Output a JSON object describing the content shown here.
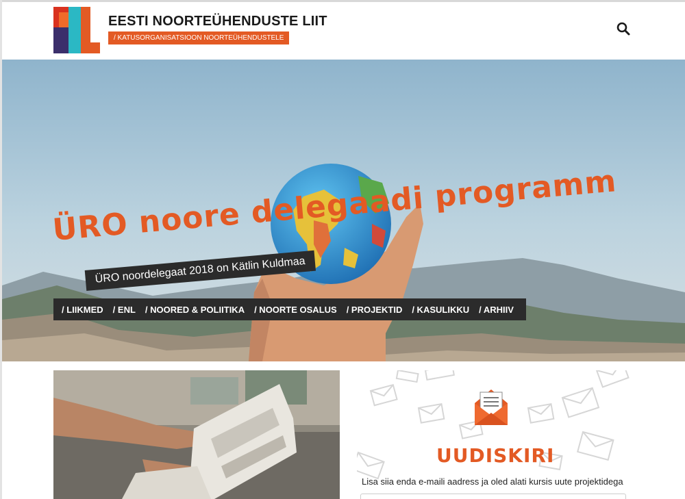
{
  "header": {
    "site_title": "EESTI NOORTEÜHENDUSTE LIIT",
    "tagline": "/ KATUSORGANISATSIOON NOORTEÜHENDUSTELE",
    "logo_icon": "enl-logo-icon",
    "search_icon": "search-icon"
  },
  "hero": {
    "headline": "ÜRO noore delegaadi programm",
    "subtitle": "ÜRO noordelegaat 2018 on Kätlin Kuldmaa"
  },
  "nav": {
    "items": [
      {
        "label": "/ LIIKMED"
      },
      {
        "label": "/ ENL"
      },
      {
        "label": "/ NOORED & POLIITIKA"
      },
      {
        "label": "/ NOORTE OSALUS"
      },
      {
        "label": "/ PROJEKTID"
      },
      {
        "label": "/ KASULIKKU"
      },
      {
        "label": "/ ARHIIV"
      }
    ]
  },
  "newsletter": {
    "title": "UUDISKIRI",
    "text": "Lisa siia enda e-maili aadress ja oled alati kursis uute projektidega",
    "email_value": "",
    "icon": "envelope-icon"
  },
  "colors": {
    "accent": "#e35a24",
    "dark": "#2b2b2b",
    "logo_teal": "#2bb8c4",
    "logo_purple": "#3b2f6b",
    "logo_red": "#d9321f"
  }
}
